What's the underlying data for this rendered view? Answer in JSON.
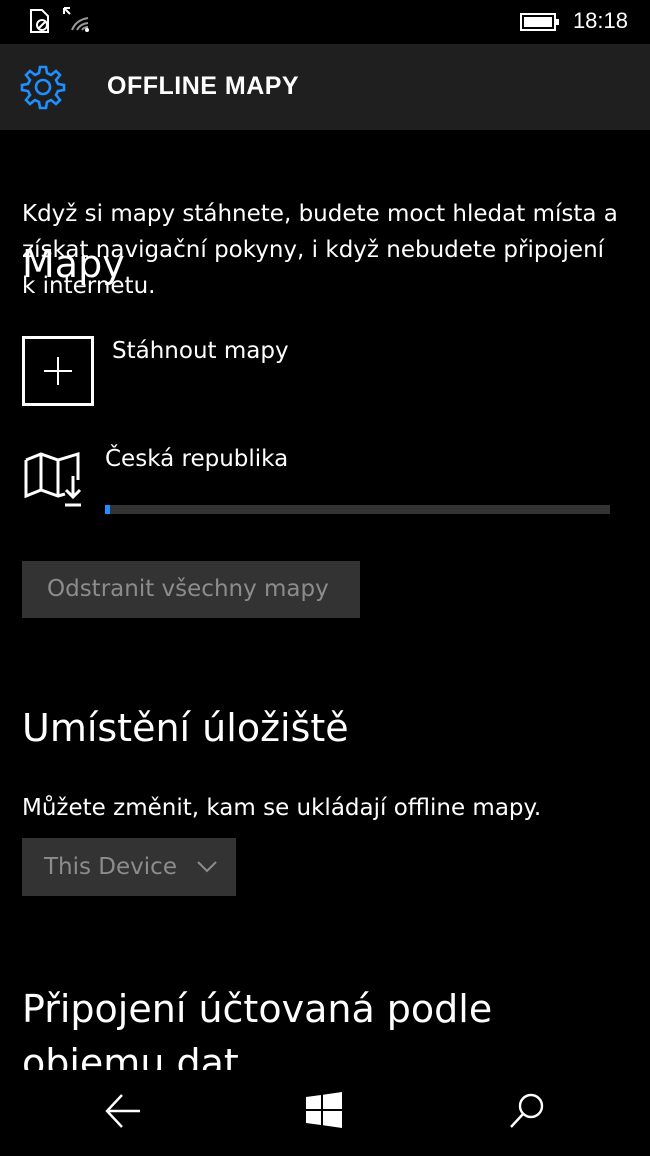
{
  "status": {
    "time": "18:18"
  },
  "header": {
    "title": "OFFLINE MAPY"
  },
  "maps": {
    "heading": "Mapy",
    "description": "Když si mapy stáhnete, budete moct hledat místa a získat navigační pokyny, i když nebudete připojení k internetu.",
    "download_label": "Stáhnout mapy",
    "map_item_label": "Česká republika",
    "download_progress_percent": 1,
    "delete_all_label": "Odstranit všechny mapy"
  },
  "storage": {
    "heading": "Umístění úložiště",
    "description": "Můžete změnit, kam se ukládají offline mapy.",
    "selected_location": "This Device"
  },
  "metered": {
    "heading": "Připojení účtovaná podle objemu dat"
  },
  "icons": [
    "no-sim-icon",
    "wifi-icon",
    "battery-icon",
    "gear-icon",
    "plus-icon",
    "map-download-icon",
    "chevron-down-icon",
    "back-icon",
    "windows-icon",
    "search-icon"
  ],
  "colors": {
    "accent": "#1e90ff",
    "header_bg": "#1f1f1f",
    "button_bg": "#333333",
    "disabled_text": "#8c8c8c"
  }
}
